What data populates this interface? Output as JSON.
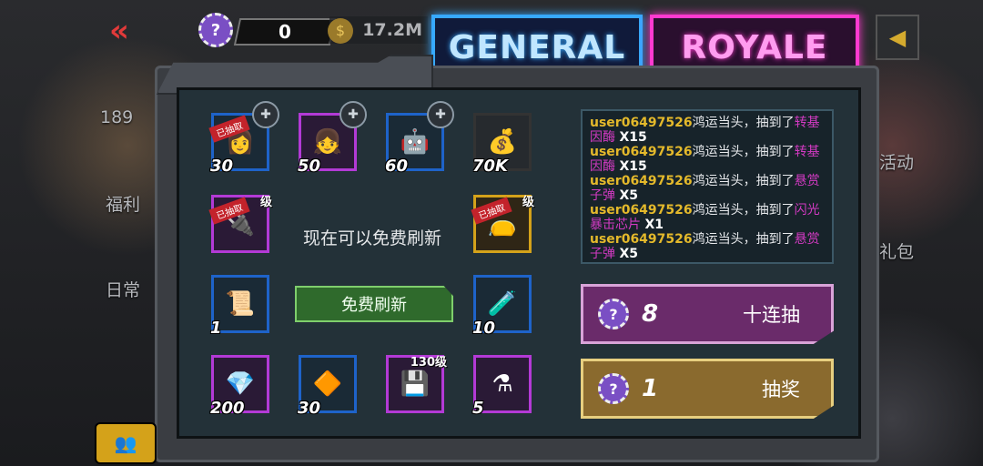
{
  "topbar": {
    "count": "0",
    "gold": "17.2M",
    "chip_glyph": "?",
    "back_glyph": "«"
  },
  "tabs": {
    "general": "GENERAL",
    "royale": "ROYALE"
  },
  "side_labels": {
    "left1": "189",
    "left2": "福利",
    "left3": "日常",
    "right1": "活动",
    "right2": "礼包"
  },
  "grid": [
    {
      "name": "cell-poster-woman",
      "num": "30",
      "style": "blue",
      "tag": "已抽取",
      "puzzle": true,
      "art": "👩"
    },
    {
      "name": "cell-girl",
      "num": "50",
      "style": "purple",
      "tag": "",
      "puzzle": true,
      "art": "👧"
    },
    {
      "name": "cell-robot",
      "num": "60",
      "style": "blue",
      "tag": "",
      "puzzle": true,
      "art": "🤖"
    },
    {
      "name": "cell-gold",
      "num": "70K",
      "style": "dark",
      "tag": "",
      "puzzle": false,
      "art": "💰"
    },
    {
      "name": "cell-chip",
      "num": "",
      "style": "purple",
      "tag": "已抽取",
      "lvl": "级",
      "puzzle": false,
      "art": "🔌"
    },
    {
      "name": "cell-pouch",
      "num": "",
      "style": "gold",
      "tag": "已抽取",
      "lvl": "级",
      "puzzle": false,
      "art": "👝"
    },
    {
      "name": "cell-scroll",
      "num": "1",
      "style": "blue",
      "tag": "",
      "puzzle": false,
      "art": "📜"
    },
    {
      "name": "cell-tube",
      "num": "10",
      "style": "blue",
      "tag": "",
      "puzzle": false,
      "art": "🧪"
    },
    {
      "name": "cell-crystals",
      "num": "200",
      "style": "purple",
      "tag": "",
      "puzzle": false,
      "art": "💎"
    },
    {
      "name": "cell-gem",
      "num": "30",
      "style": "blue",
      "tag": "",
      "puzzle": false,
      "art": "🔶"
    },
    {
      "name": "cell-chip-130",
      "num": "",
      "style": "purple",
      "tag": "",
      "lvl": "130级",
      "puzzle": false,
      "art": "💾"
    },
    {
      "name": "cell-potion",
      "num": "5",
      "style": "purple",
      "tag": "",
      "puzzle": false,
      "art": "⚗"
    }
  ],
  "refresh": {
    "info": "现在可以免费刷新",
    "button": "免费刷新"
  },
  "log": [
    {
      "user": "user06497526",
      "mid": "鸿运当头，抽到了",
      "item": "转基因酶",
      "qty": "X15"
    },
    {
      "user": "user06497526",
      "mid": "鸿运当头，抽到了",
      "item": "转基因酶",
      "qty": "X15"
    },
    {
      "user": "user06497526",
      "mid": "鸿运当头，抽到了",
      "item": "悬赏子弹",
      "qty": "X5"
    },
    {
      "user": "user06497526",
      "mid": "鸿运当头，抽到了",
      "item": "闪光暴击芯片",
      "qty": "X1"
    },
    {
      "user": "user06497526",
      "mid": "鸿运当头，抽到了",
      "item": "悬赏子弹",
      "qty": "X5"
    }
  ],
  "draws": {
    "ten": {
      "qty": "8",
      "label": "十连抽"
    },
    "one": {
      "qty": "1",
      "label": "抽奖"
    }
  },
  "colors": {
    "general": "#37a9ff",
    "royale": "#ff3ad0"
  }
}
